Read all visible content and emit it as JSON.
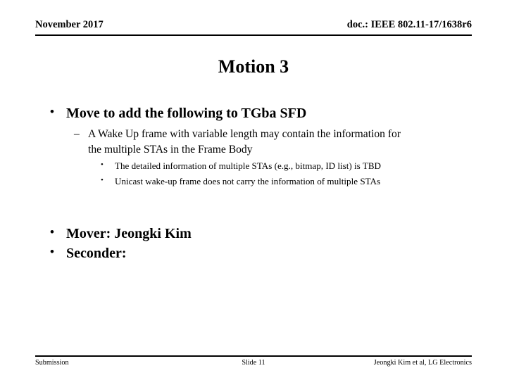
{
  "header": {
    "left": "November 2017",
    "right": "doc.: IEEE 802.11-17/1638r6"
  },
  "title": "Motion 3",
  "body": {
    "bullets": [
      {
        "level": 1,
        "marker": "•",
        "text": "Move to add the following to TGba SFD"
      },
      {
        "level": 2,
        "marker": "–",
        "text": "A Wake Up frame with variable length may contain the information for the multiple STAs in the Frame Body"
      },
      {
        "level": 3,
        "marker": "•",
        "text": "The detailed information of multiple STAs (e.g., bitmap, ID list) is TBD"
      },
      {
        "level": 3,
        "marker": "•",
        "text": "Unicast wake-up frame does not carry the information of multiple STAs"
      },
      {
        "level": 1,
        "marker": "•",
        "text": "Mover: Jeongki Kim"
      },
      {
        "level": 1,
        "marker": "•",
        "text": "Seconder:"
      }
    ]
  },
  "footer": {
    "left": "Submission",
    "center": "Slide 11",
    "right": "Jeongki Kim et al, LG Electronics"
  }
}
